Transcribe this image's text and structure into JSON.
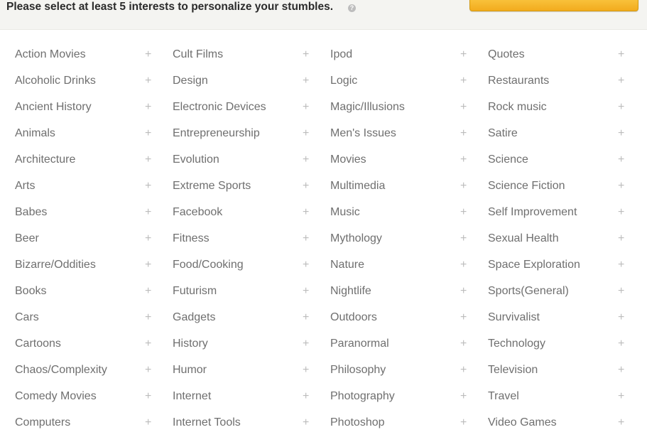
{
  "header": {
    "prompt": "Please select at least 5 interests to personalize your stumbles.",
    "help_icon": "?",
    "continue_button_color": "#f2ab1d"
  },
  "plus_glyph": "+",
  "columns": [
    [
      "Action Movies",
      "Alcoholic Drinks",
      "Ancient History",
      "Animals",
      "Architecture",
      "Arts",
      "Babes",
      "Beer",
      "Bizarre/Oddities",
      "Books",
      "Cars",
      "Cartoons",
      "Chaos/Complexity",
      "Comedy Movies",
      "Computers"
    ],
    [
      "Cult Films",
      "Design",
      "Electronic Devices",
      "Entrepreneurship",
      "Evolution",
      "Extreme Sports",
      "Facebook",
      "Fitness",
      "Food/Cooking",
      "Futurism",
      "Gadgets",
      "History",
      "Humor",
      "Internet",
      "Internet Tools"
    ],
    [
      "Ipod",
      "Logic",
      "Magic/Illusions",
      "Men's Issues",
      "Movies",
      "Multimedia",
      "Music",
      "Mythology",
      "Nature",
      "Nightlife",
      "Outdoors",
      "Paranormal",
      "Philosophy",
      "Photography",
      "Photoshop"
    ],
    [
      "Quotes",
      "Restaurants",
      "Rock music",
      "Satire",
      "Science",
      "Science Fiction",
      "Self Improvement",
      "Sexual Health",
      "Space Exploration",
      "Sports(General)",
      "Survivalist",
      "Technology",
      "Television",
      "Travel",
      "Video Games"
    ]
  ]
}
